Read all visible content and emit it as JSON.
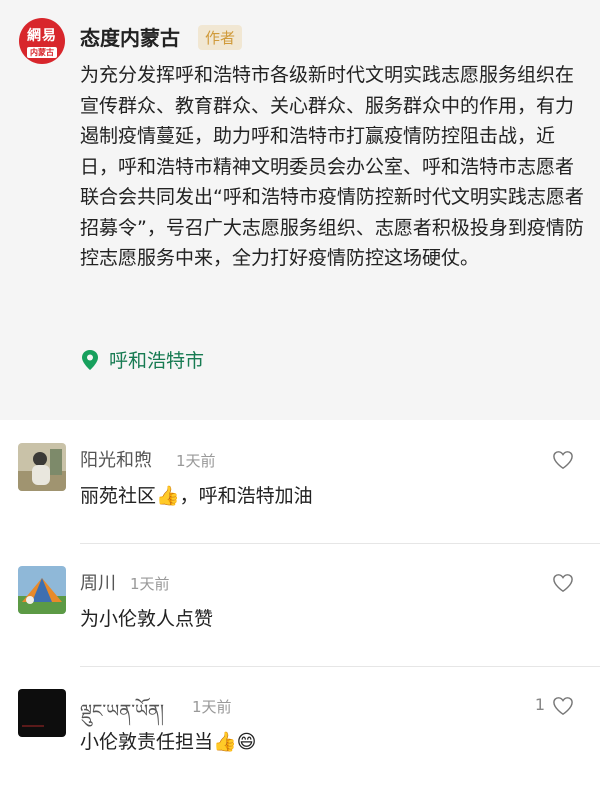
{
  "post": {
    "author": "态度内蒙古",
    "author_badge": "作者",
    "avatar_text": "網易",
    "avatar_subtext": "内蒙古",
    "body": "为充分发挥呼和浩特市各级新时代文明实践志愿服务组织在宣传群众、教育群众、关心群众、服务群众中的作用，有力遏制疫情蔓延，助力呼和浩特市打赢疫情防控阻击战，近日，呼和浩特市精神文明委员会办公室、呼和浩特市志愿者联合会共同发出“呼和浩特市疫情防控新时代文明实践志愿者招募令”，号召广大志愿服务组织、志愿者积极投身到疫情防控志愿服务中来，全力打好疫情防控这场硬仗。",
    "location": "呼和浩特市",
    "location_icon": "location-pin-icon"
  },
  "comments": [
    {
      "name": "阳光和煦",
      "time": "1天前",
      "text": "丽苑社区👍，呼和浩特加油",
      "likes": "",
      "like_icon": "heart-outline-icon"
    },
    {
      "name": "周川",
      "time": "1天前",
      "text": "为小伦敦人点赞",
      "likes": "",
      "like_icon": "heart-outline-icon"
    },
    {
      "name": "ལྡུང་ཡན་ཡོན།",
      "time": "1天前",
      "text": "小伦敦责任担当👍😄",
      "likes": "1",
      "like_icon": "heart-outline-icon"
    }
  ],
  "colors": {
    "brand_red": "#d8262c",
    "location_green": "#177b52",
    "badge_text": "#d09a3a"
  }
}
